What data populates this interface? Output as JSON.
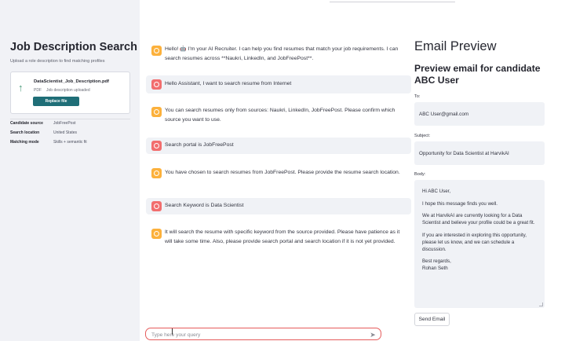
{
  "sidebar": {
    "title": "Job Description Search",
    "subtitle": "Upload a role description to find matching profiles",
    "file": {
      "name": "DataScientist_Job_Description.pdf",
      "type": "PDF",
      "status": "Job description uploaded",
      "replace_label": "Replace file",
      "icon": "upload-arrow-icon"
    },
    "meta": [
      {
        "key": "Candidate source",
        "value": "JobFreePost"
      },
      {
        "key": "Search location",
        "value": "United States"
      },
      {
        "key": "Matching mode",
        "value": "Skills + semantic fit"
      }
    ]
  },
  "chat": {
    "messages": [
      {
        "role": "assistant",
        "text": "Hello! 🤖 I'm your AI Recruiter. I can help you find resumes that match your job requirements. I can search resumes across **Naukri, LinkedIn, and JobFreePost**."
      },
      {
        "role": "user",
        "text": "Hello Assistant, I want to search resume from Internet"
      },
      {
        "role": "assistant",
        "text": "You can search resumes only from sources: Naukri, LinkedIn, JobFreePost. Please confirm which source you want to use."
      },
      {
        "role": "user",
        "text": "Search portal is JobFreePost"
      },
      {
        "role": "assistant",
        "text": "You have chosen to search resumes from JobFreePost. Please provide the resume search location."
      },
      {
        "role": "user",
        "text": "Search Keyword is Data Scientist"
      },
      {
        "role": "assistant",
        "text": "It will search the resume with specific keyword from the source provided. Please have patience as it will take some time. Also, please provide search portal and search location if it is not yet provided."
      }
    ],
    "input_placeholder": "Type here your query"
  },
  "email": {
    "heading": "Email Preview",
    "subheading": "Preview email for candidate ABC User",
    "to_label": "To:",
    "to_value": "ABC User@gmail.com",
    "subject_label": "Subject:",
    "subject_value": "Opportunity for Data Scientist at HarvikAI",
    "body_label": "Body:",
    "body": {
      "greeting": "Hi ABC User,",
      "p1": "I hope this message finds you well.",
      "p2": "We at HarvikAI are currently looking for a Data Scientist and believe your profile could be a great fit.",
      "p3": "If you are interested in exploring this opportunity, please let us know, and we can schedule a discussion.",
      "closing": "Best regards,",
      "sender": "Rohan Seth"
    },
    "send_label": "Send Email"
  },
  "colors": {
    "assistant_avatar": "#fcb13c",
    "user_avatar": "#f26e6e",
    "input_border": "#e55c5c",
    "replace_button": "#1f6e77"
  }
}
